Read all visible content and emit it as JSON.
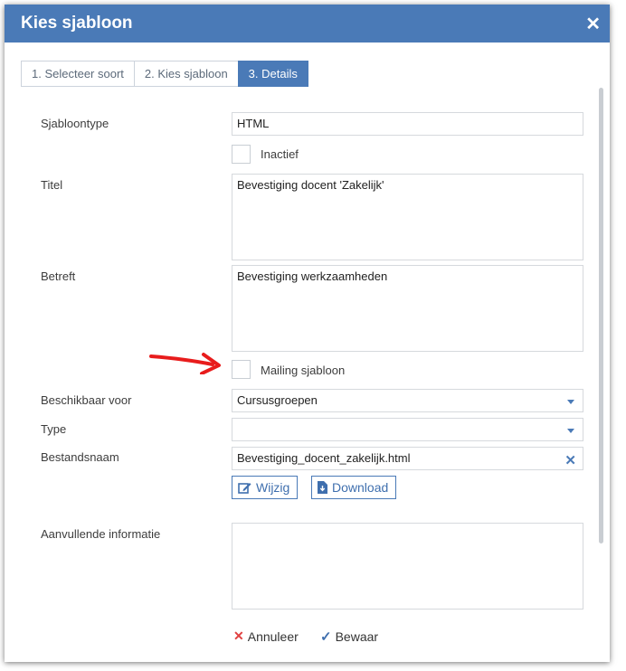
{
  "dialog": {
    "title": "Kies sjabloon"
  },
  "tabs": [
    {
      "label": "1. Selecteer soort",
      "active": false
    },
    {
      "label": "2. Kies sjabloon",
      "active": false
    },
    {
      "label": "3. Details",
      "active": true
    }
  ],
  "form": {
    "sjabloontype": {
      "label": "Sjabloontype",
      "value": "HTML"
    },
    "inactief": {
      "label": "Inactief",
      "checked": false
    },
    "titel": {
      "label": "Titel",
      "value": "Bevestiging docent 'Zakelijk'"
    },
    "betreft": {
      "label": "Betreft",
      "value": "Bevestiging werkzaamheden"
    },
    "mailing": {
      "label": "Mailing sjabloon",
      "checked": false
    },
    "beschikbaar": {
      "label": "Beschikbaar voor",
      "value": "Cursusgroepen"
    },
    "type": {
      "label": "Type",
      "value": ""
    },
    "bestandsnaam": {
      "label": "Bestandsnaam",
      "value": "Bevestiging_docent_zakelijk.html"
    },
    "aanvullend": {
      "label": "Aanvullende informatie",
      "value": ""
    }
  },
  "buttons": {
    "wijzig": "Wijzig",
    "download": "Download",
    "annuleer": "Annuleer",
    "bewaar": "Bewaar"
  },
  "icons": {
    "close": "close-icon",
    "edit": "edit-icon",
    "download": "file-download-icon",
    "cancel": "cross-icon",
    "save": "check-icon",
    "arrow": "red-arrow-icon",
    "clear": "clear-icon"
  },
  "colors": {
    "header": "#4a7ab7",
    "accent": "#4a7ab7",
    "cancel": "#e04040",
    "annotation": "#e81c1c"
  }
}
